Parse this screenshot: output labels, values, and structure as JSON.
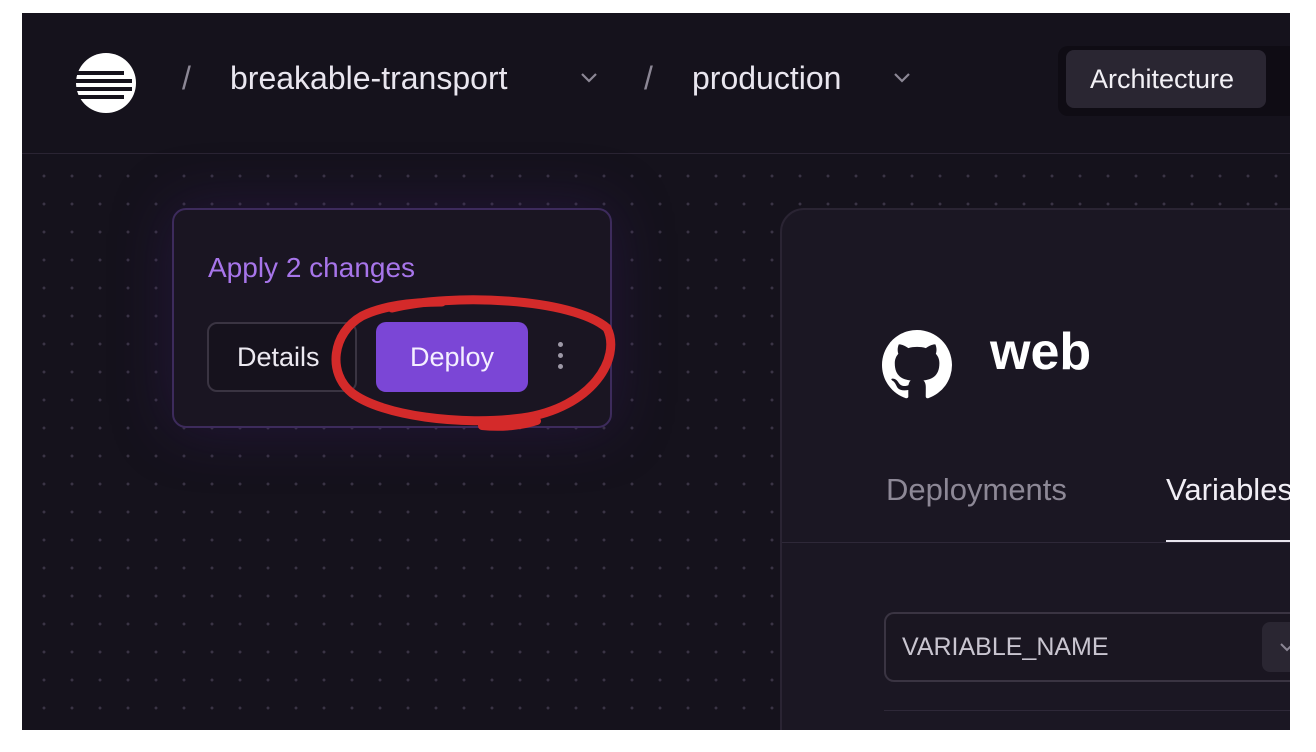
{
  "header": {
    "separator": "/",
    "project": "breakable-transport",
    "environment": "production",
    "architecture_label": "Architecture"
  },
  "changes_card": {
    "title": "Apply 2 changes",
    "details_label": "Details",
    "deploy_label": "Deploy"
  },
  "service": {
    "name": "web",
    "tabs": [
      "Deployments",
      "Variables"
    ],
    "active_tab": "Variables",
    "variable_name_placeholder": "VARIABLE_NAME"
  },
  "colors": {
    "background": "#15121c",
    "accent": "#7b46d6",
    "accent_text": "#a775ea",
    "annotation": "#d42a2a"
  }
}
